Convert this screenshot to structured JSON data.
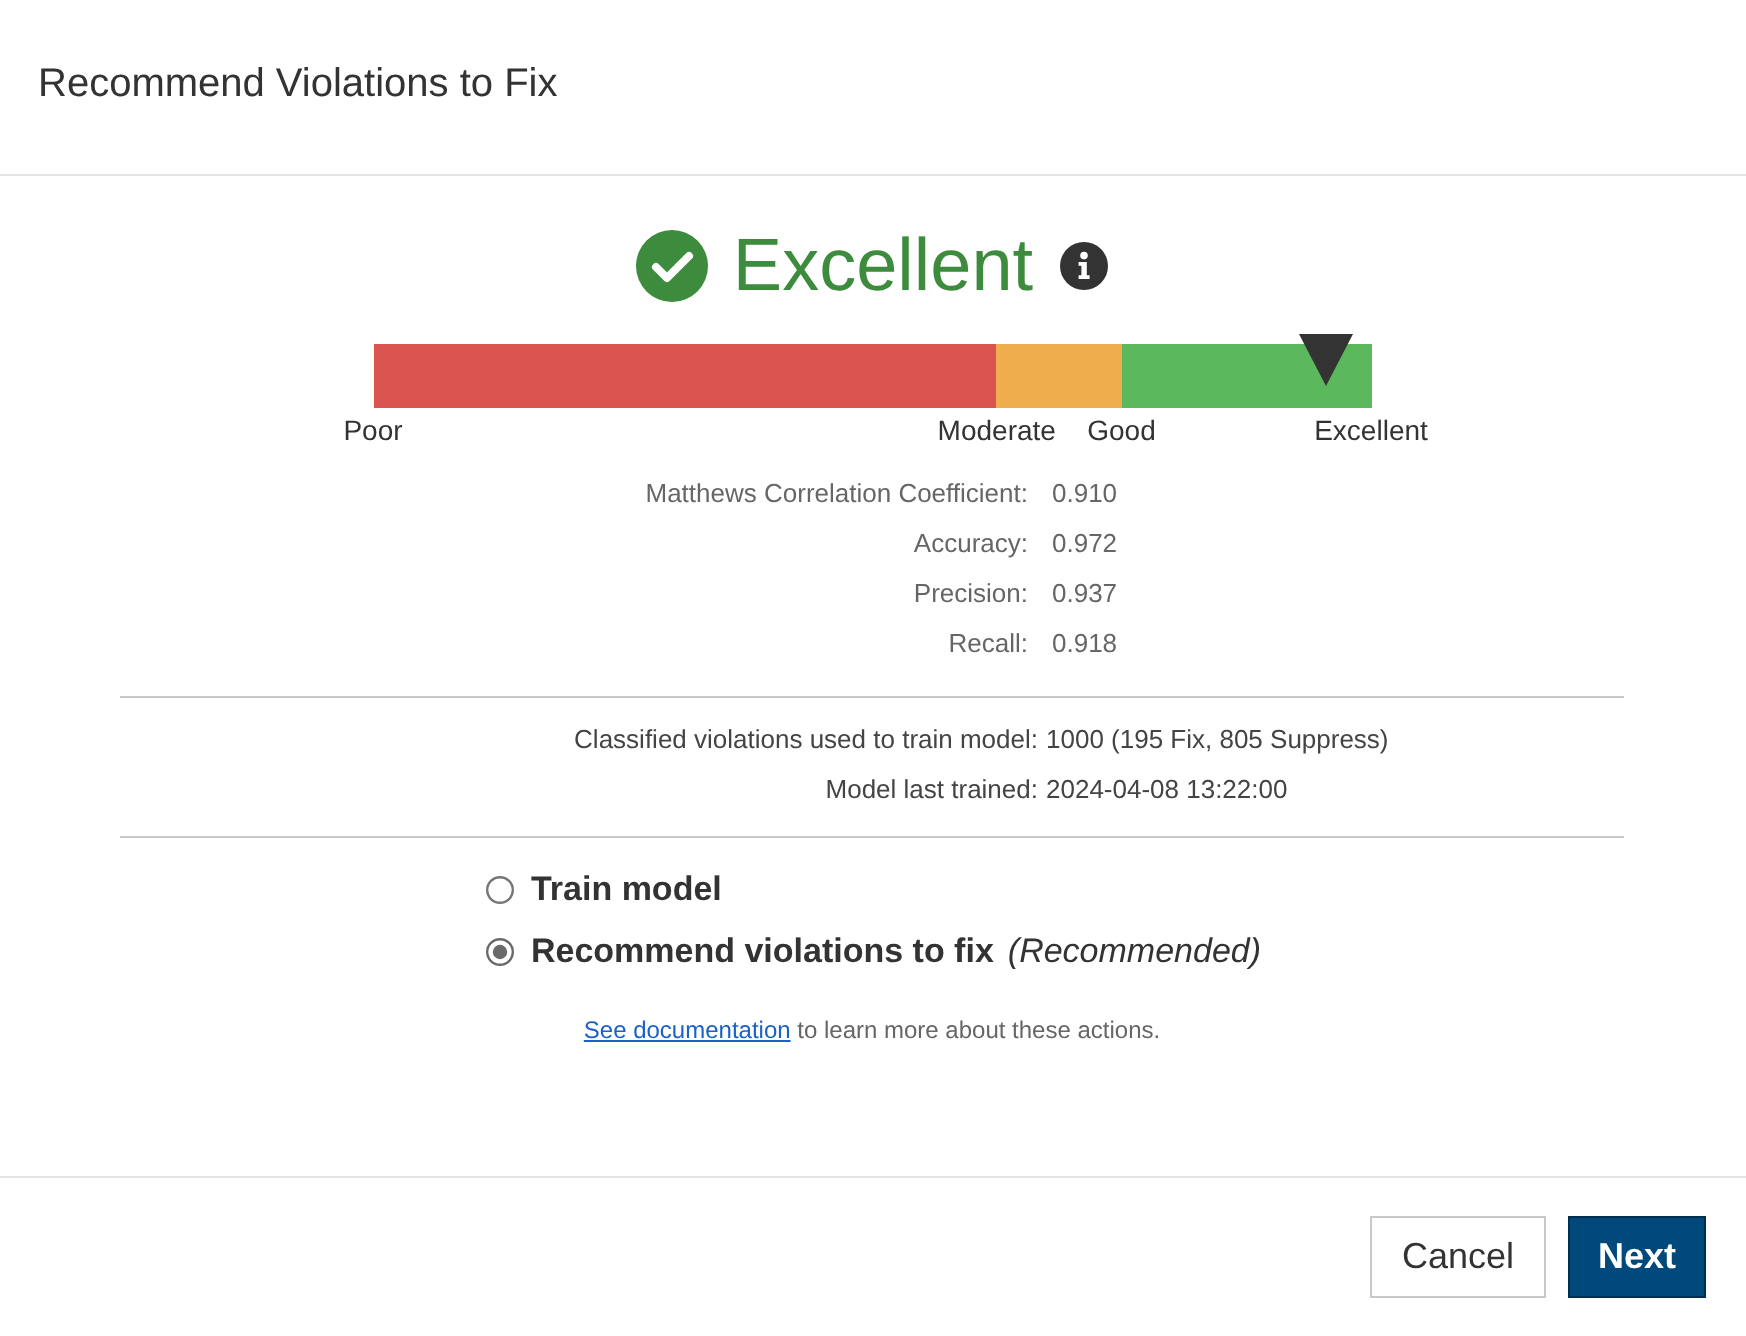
{
  "dialog": {
    "title": "Recommend Violations to Fix"
  },
  "rating": {
    "label": "Excellent"
  },
  "gauge": {
    "segments": [
      {
        "color": "#d9534f"
      },
      {
        "color": "#f0ad4e"
      },
      {
        "color": "#5cb85c"
      }
    ],
    "scale_labels": [
      "Poor",
      "Moderate",
      "Good",
      "Excellent"
    ],
    "marker": {
      "level": 0.954
    }
  },
  "metrics": [
    {
      "label": "Matthews Correlation Coefficient:",
      "value": "0.910"
    },
    {
      "label": "Accuracy:",
      "value": "0.972"
    },
    {
      "label": "Precision:",
      "value": "0.937"
    },
    {
      "label": "Recall:",
      "value": "0.918"
    }
  ],
  "training_info": [
    {
      "label": "Classified violations used to train model:",
      "value": "1000 (195 Fix, 805 Suppress)"
    },
    {
      "label": "Model last trained:",
      "value": "2024-04-08 13:22:00"
    }
  ],
  "actions": [
    {
      "label": "Train model",
      "selected": false
    },
    {
      "label": "Recommend violations to fix",
      "note": "(Recommended)",
      "selected": true
    }
  ],
  "help": {
    "link": "See documentation",
    "text": "to learn more about these actions."
  },
  "buttons": [
    {
      "label": "Cancel",
      "kind": "secondary"
    },
    {
      "label": "Next",
      "kind": "primary"
    }
  ]
}
